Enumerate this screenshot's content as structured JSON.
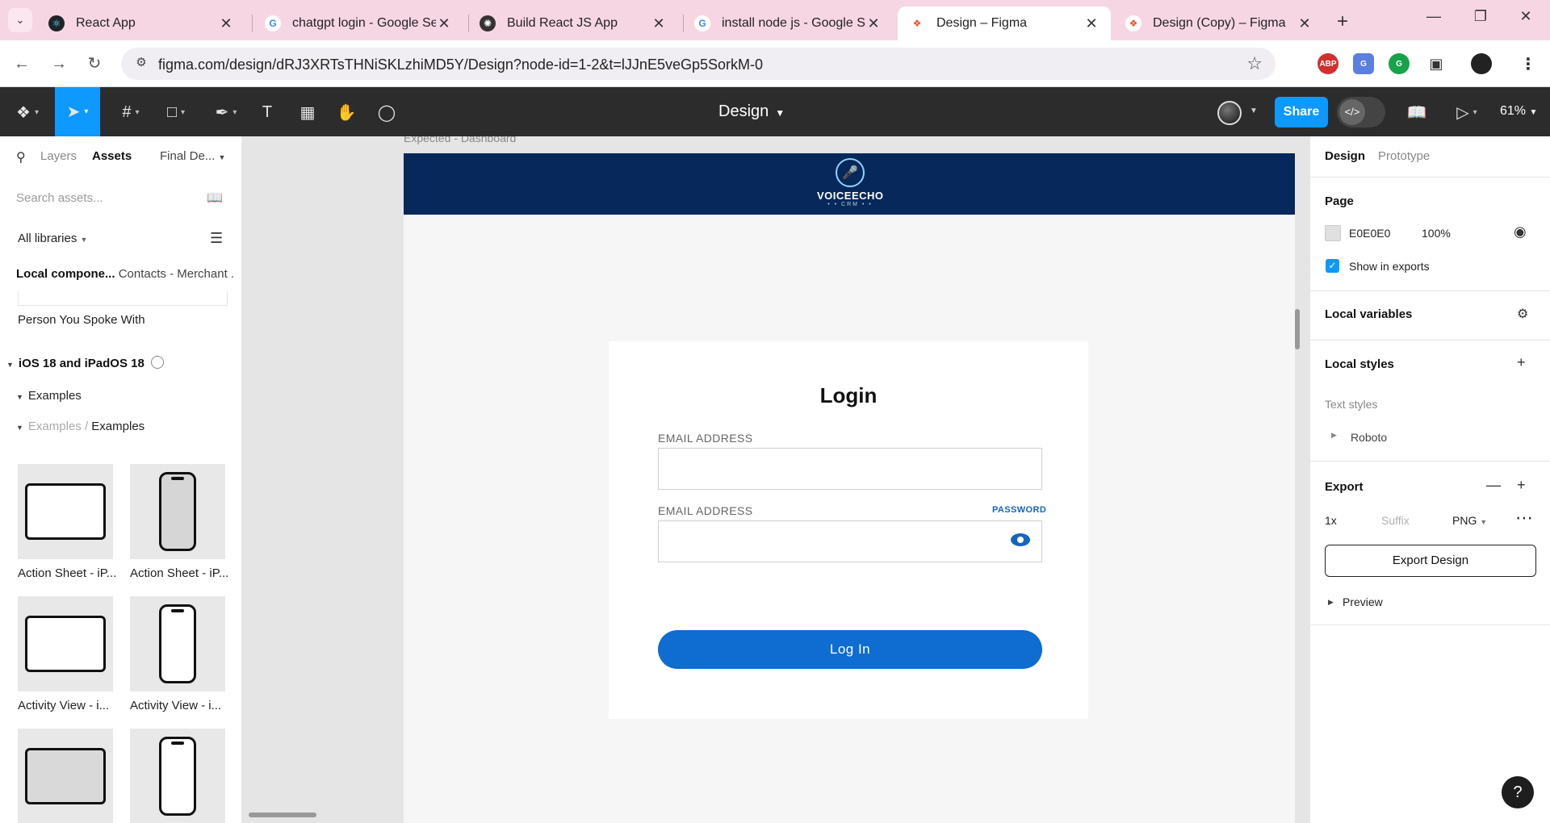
{
  "browser": {
    "tabs": [
      {
        "title": "React App",
        "favicon": "react-icon"
      },
      {
        "title": "chatgpt login - Google Sea",
        "favicon": "google-icon"
      },
      {
        "title": "Build React JS App",
        "favicon": "chatgpt-icon"
      },
      {
        "title": "install node js - Google Sea",
        "favicon": "google-icon"
      },
      {
        "title": "Design – Figma",
        "favicon": "figma-icon",
        "active": true
      },
      {
        "title": "Design (Copy) – Figma",
        "favicon": "figma-icon"
      }
    ],
    "url": "figma.com/design/dRJ3XRTsTHNiSKLzhiMD5Y/Design?node-id=1-2&t=lJJnE5veGp5SorkM-0",
    "extensions": [
      "adblock-icon",
      "translate-icon",
      "grammarly-icon",
      "puzzle-icon",
      "profile-icon"
    ],
    "tab_bg": "#f7d6e4"
  },
  "figma": {
    "document_title": "Design",
    "share_label": "Share",
    "zoom": "61%",
    "accent": "#0d99ff",
    "tools": [
      "figma-menu-icon",
      "move-tool-icon",
      "frame-tool-icon",
      "shape-tool-icon",
      "pen-tool-icon",
      "text-tool-icon",
      "resources-icon",
      "hand-tool-icon",
      "comment-icon"
    ]
  },
  "left_panel": {
    "tabs": {
      "layers": "Layers",
      "assets": "Assets",
      "page": "Final De..."
    },
    "search_placeholder": "Search assets...",
    "libraries": "All libraries",
    "local_components": "Local compone...",
    "breadcrumb": "Contacts - Merchant ...",
    "person_item": "Person You Spoke With",
    "library_name": "iOS 18 and iPadOS 18",
    "group": "Examples",
    "subgroup_parent": "Examples /",
    "subgroup": "Examples",
    "thumbnails": [
      {
        "label": "Action Sheet - iP...",
        "device": "ipad"
      },
      {
        "label": "Action Sheet - iP...",
        "device": "iphone"
      },
      {
        "label": "Activity View - i...",
        "device": "ipad"
      },
      {
        "label": "Activity View - i...",
        "device": "iphone"
      },
      {
        "label": "",
        "device": "ipad"
      },
      {
        "label": "",
        "device": "iphone"
      }
    ]
  },
  "canvas": {
    "frame_label": "Expected - Dashboard",
    "logo": {
      "word": "VOICEECHO",
      "sub": "• • CRM • •"
    },
    "header_color": "#06285b",
    "login": {
      "title": "Login",
      "email_label": "EMAIL ADDRESS",
      "password_label": "EMAIL ADDRESS",
      "password_link": "PASSWORD",
      "button": "Log In",
      "button_color": "#0f6cd0"
    }
  },
  "right_panel": {
    "tabs": {
      "design": "Design",
      "prototype": "Prototype"
    },
    "page_heading": "Page",
    "page_color": "E0E0E0",
    "page_opacity": "100%",
    "show_in_exports": "Show in exports",
    "local_variables": "Local variables",
    "local_styles": "Local styles",
    "text_styles": "Text styles",
    "font_style": "Roboto",
    "export_heading": "Export",
    "export_scale": "1x",
    "suffix_placeholder": "Suffix",
    "export_format": "PNG",
    "export_button": "Export Design",
    "preview": "Preview"
  },
  "help": "?"
}
